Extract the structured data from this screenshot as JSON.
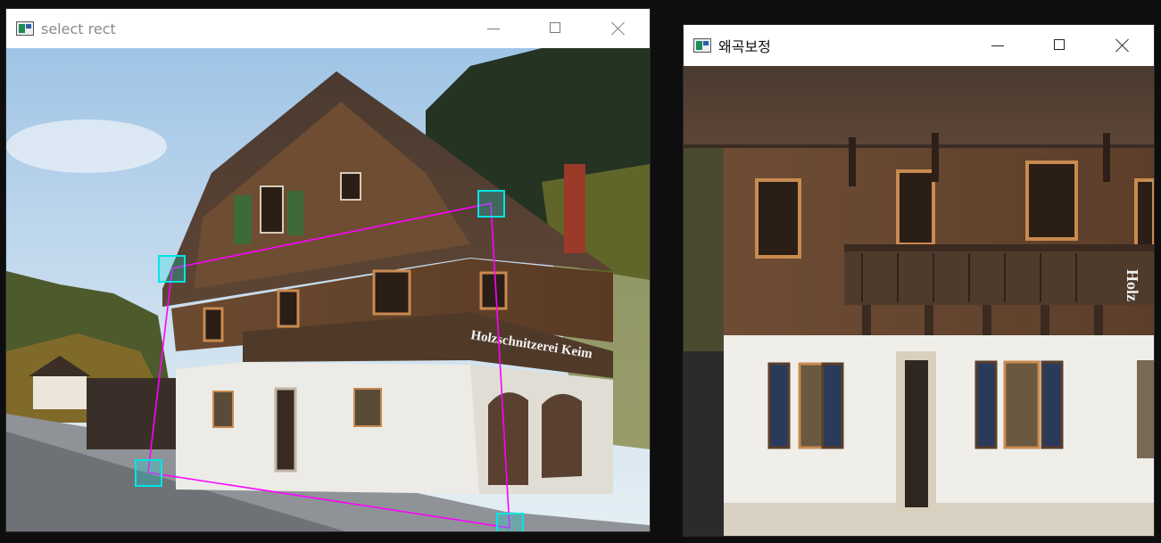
{
  "windows": {
    "left": {
      "title": "select rect",
      "sign_text": "Holzschnitzerei Keim"
    },
    "right": {
      "title": "왜곡보정",
      "sign_text": "Holz"
    }
  },
  "icons": {
    "app": "app-window-icon",
    "minimize": "minimize-icon",
    "maximize": "maximize-icon",
    "close": "close-icon"
  },
  "colors": {
    "selection_line": "#ff00ff",
    "corner_handle": "#00e5e5"
  }
}
